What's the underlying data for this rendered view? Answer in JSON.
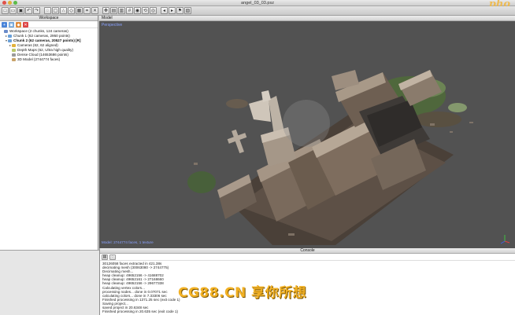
{
  "window": {
    "title": "angel_03_03.psz"
  },
  "watermark_top": "pho",
  "watermark_bottom": "CG88.CN 享你所想",
  "toolbar": {
    "buttons": [
      "new-icon",
      "open-icon",
      "save-icon",
      "undo-icon",
      "redo-icon",
      "lasso-icon",
      "rect-select-icon",
      "point-cloud-icon",
      "mesh-icon",
      "texture-icon",
      "crop-icon",
      "close-icon",
      "navigate-icon",
      "view-front-icon",
      "view-top-icon",
      "grid-icon",
      "camera-icon",
      "reset-view-icon",
      "eye-icon",
      "arrow-left-icon",
      "arrow-right-icon",
      "marker-icon",
      "mask-icon"
    ]
  },
  "workspace": {
    "header": "Workspace",
    "tree": [
      {
        "label": "Workspace (2 chunks, 124 cameras)",
        "level": 0,
        "icon_color": "#6a8bc9",
        "arrow": "",
        "selected": false
      },
      {
        "label": "Chunk 1 (62 cameras, 2950 points)",
        "level": 1,
        "icon_color": "#6aa0d8",
        "arrow": "▸",
        "selected": false
      },
      {
        "label": "Chunk 2 (62 cameras, 20527 points) [R]",
        "level": 1,
        "icon_color": "#6aa0d8",
        "arrow": "▾",
        "selected": false,
        "bold": true
      },
      {
        "label": "Cameras (62, 62 aligned)",
        "level": 2,
        "icon_color": "#e3b23a",
        "arrow": "▸",
        "selected": false
      },
      {
        "label": "Depth Maps (62, Ultra high quality)",
        "level": 2,
        "icon_color": "#b9c86a",
        "arrow": "",
        "selected": false
      },
      {
        "label": "Dense Cloud (14653686 points)",
        "level": 2,
        "icon_color": "#9a9a9a",
        "arrow": "",
        "selected": false
      },
      {
        "label": "3D Model (2744774 faces)",
        "level": 2,
        "icon_color": "#c8a36a",
        "arrow": "",
        "selected": false
      }
    ]
  },
  "model": {
    "header": "Model",
    "perspective": "Perspective",
    "status": "Model: 2744774 faces, 1 texture"
  },
  "console": {
    "header": "Console",
    "log": [
      "30126058 faces extracted in 421.38s",
      "decimating mesh (30063080 -> 2744775)",
      "Decimating mesh...",
      "heap cleanup: 49652156 -> 41688702",
      "heap cleanup: 49652161 -> 27168660",
      "heap cleanup: 49652156 -> 29677338",
      "Calculating vertex colors...",
      "processing nodes... done in 0.07071 sec",
      "calculating colors... done in 7.33306 sec",
      "Finished processing in 1371.25 sec (exit code 1)",
      "Saving project...",
      "saved project in 20.6348 sec",
      "Finished processing in 20.635 sec (exit code 1)"
    ]
  },
  "colors": {
    "viewport_bg": "#525252",
    "accent_blue": "#3d6ee0",
    "viewport_text": "#8aa2ff",
    "watermark": "#f2b124"
  }
}
